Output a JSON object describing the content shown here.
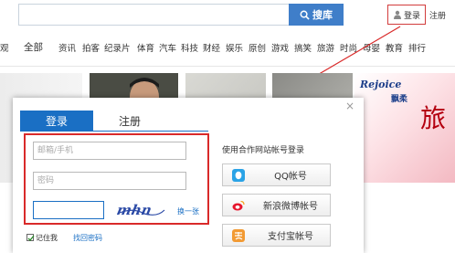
{
  "header": {
    "search_button_label": "搜库",
    "login_label": "登录",
    "register_label": "注册"
  },
  "nav": {
    "items": [
      {
        "label": "观",
        "big": false
      },
      {
        "label": "全部",
        "big": true
      },
      {
        "label": "资讯",
        "big": false
      },
      {
        "label": "拍客",
        "big": false
      },
      {
        "label": "纪录片",
        "big": false
      },
      {
        "label": "体育",
        "big": false
      },
      {
        "label": "汽车",
        "big": false
      },
      {
        "label": "科技",
        "big": false
      },
      {
        "label": "财经",
        "big": false
      },
      {
        "label": "娱乐",
        "big": false
      },
      {
        "label": "原创",
        "big": false
      },
      {
        "label": "游戏",
        "big": false
      },
      {
        "label": "搞笑",
        "big": false
      },
      {
        "label": "旅游",
        "big": false
      },
      {
        "label": "时尚",
        "big": false
      },
      {
        "label": "母婴",
        "big": false
      },
      {
        "label": "教育",
        "big": false
      },
      {
        "label": "排行",
        "big": false
      }
    ]
  },
  "ad": {
    "brand": "Rejoice",
    "sub": "飘柔",
    "big_char": "旅"
  },
  "modal": {
    "close_glyph": "×",
    "tab_login": "登录",
    "tab_register": "注册",
    "account_placeholder": "邮箱/手机",
    "password_placeholder": "密码",
    "captcha_text": "mhn",
    "captcha_refresh": "换一张",
    "remember_label": "记住我",
    "forgot_label": "找回密码",
    "partner_title": "使用合作网站帐号登录",
    "partners": [
      {
        "label": "QQ帐号",
        "icon": "qq-icon"
      },
      {
        "label": "新浪微博帐号",
        "icon": "weibo-icon"
      },
      {
        "label": "支付宝帐号",
        "icon": "alipay-icon"
      }
    ]
  },
  "colors": {
    "accent_blue": "#1a6fc4",
    "search_blue": "#3f7ec9",
    "highlight_red": "#d92a2a"
  }
}
